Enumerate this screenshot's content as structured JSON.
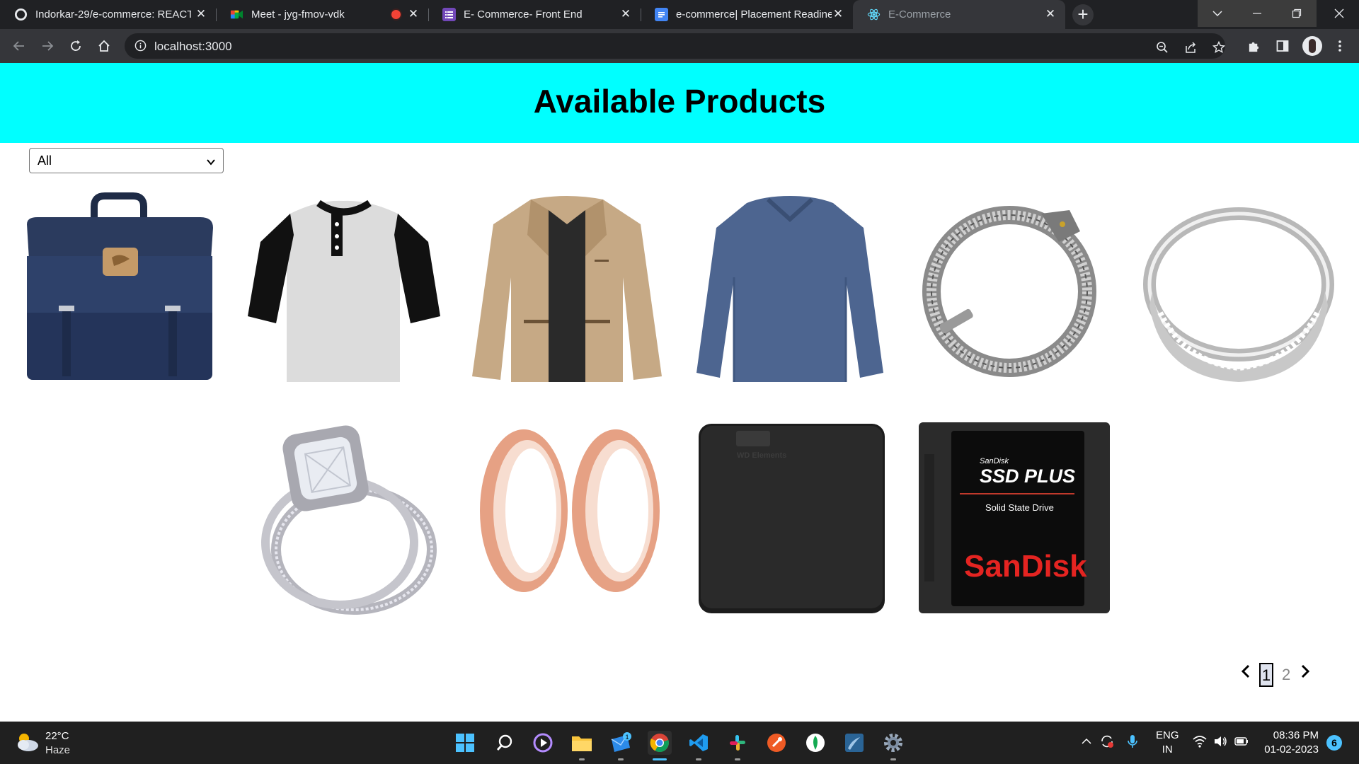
{
  "browser": {
    "tabs": [
      {
        "title": "Indorkar-29/e-commerce: REACT",
        "icon": "github-icon"
      },
      {
        "title": "Meet - jyg-fmov-vdk",
        "icon": "google-meet-icon"
      },
      {
        "title": "E- Commerce- Front End",
        "icon": "google-forms-icon"
      },
      {
        "title": "e-commerce| Placement Readine",
        "icon": "google-docs-icon"
      },
      {
        "title": "E-Commerce",
        "icon": "react-icon",
        "active": true
      }
    ],
    "url": "localhost:3000"
  },
  "page": {
    "title": "Available Products",
    "category_filter": {
      "selected": "All"
    },
    "products": [
      {
        "name": "backpack",
        "icon": "backpack-image"
      },
      {
        "name": "henley-tshirt",
        "icon": "tshirt-image"
      },
      {
        "name": "jacket",
        "icon": "jacket-image"
      },
      {
        "name": "long-sleeve-shirt",
        "icon": "shirt-image"
      },
      {
        "name": "dragon-bracelet",
        "icon": "bracelet-image"
      },
      {
        "name": "silver-ring",
        "icon": "ring-image"
      },
      {
        "name": "engagement-ring",
        "icon": "diamond-ring-image"
      },
      {
        "name": "rose-gold-plugs",
        "icon": "ear-plugs-image"
      },
      {
        "name": "wd-external-drive",
        "icon": "hard-drive-image"
      },
      {
        "name": "sandisk-ssd",
        "icon": "ssd-image"
      }
    ],
    "ssd_label": {
      "brand_small": "SanDisk",
      "model": "SSD PLUS",
      "subtitle": "Solid State Drive",
      "brand": "SanDisk"
    },
    "hdd_label": "WD Elements",
    "pagination": {
      "pages": [
        "1",
        "2"
      ],
      "current": "1"
    }
  },
  "taskbar": {
    "weather": {
      "temp": "22°C",
      "condition": "Haze"
    },
    "language": {
      "line1": "ENG",
      "line2": "IN"
    },
    "clock": {
      "time": "08:36 PM",
      "date": "01-02-2023"
    },
    "notifications": "6",
    "mail_badge": "1"
  },
  "colors": {
    "header": "#00ffff",
    "chrome_dark": "#202124",
    "chrome_toolbar": "#35363a",
    "taskbar": "#202020"
  }
}
